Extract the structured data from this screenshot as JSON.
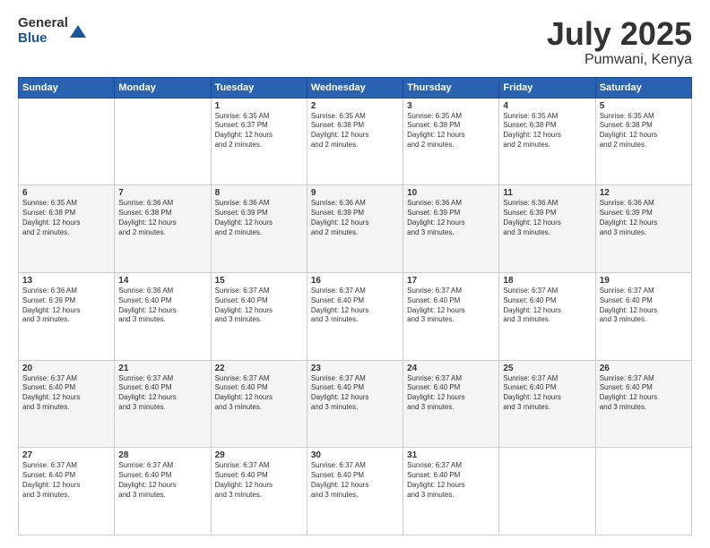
{
  "logo": {
    "general": "General",
    "blue": "Blue"
  },
  "title": {
    "month": "July 2025",
    "location": "Pumwani, Kenya"
  },
  "days_header": [
    "Sunday",
    "Monday",
    "Tuesday",
    "Wednesday",
    "Thursday",
    "Friday",
    "Saturday"
  ],
  "weeks": [
    [
      {
        "num": "",
        "info": ""
      },
      {
        "num": "",
        "info": ""
      },
      {
        "num": "1",
        "info": "Sunrise: 6:35 AM\nSunset: 6:37 PM\nDaylight: 12 hours\nand 2 minutes."
      },
      {
        "num": "2",
        "info": "Sunrise: 6:35 AM\nSunset: 6:38 PM\nDaylight: 12 hours\nand 2 minutes."
      },
      {
        "num": "3",
        "info": "Sunrise: 6:35 AM\nSunset: 6:38 PM\nDaylight: 12 hours\nand 2 minutes."
      },
      {
        "num": "4",
        "info": "Sunrise: 6:35 AM\nSunset: 6:38 PM\nDaylight: 12 hours\nand 2 minutes."
      },
      {
        "num": "5",
        "info": "Sunrise: 6:35 AM\nSunset: 6:38 PM\nDaylight: 12 hours\nand 2 minutes."
      }
    ],
    [
      {
        "num": "6",
        "info": "Sunrise: 6:35 AM\nSunset: 6:38 PM\nDaylight: 12 hours\nand 2 minutes."
      },
      {
        "num": "7",
        "info": "Sunrise: 6:36 AM\nSunset: 6:38 PM\nDaylight: 12 hours\nand 2 minutes."
      },
      {
        "num": "8",
        "info": "Sunrise: 6:36 AM\nSunset: 6:39 PM\nDaylight: 12 hours\nand 2 minutes."
      },
      {
        "num": "9",
        "info": "Sunrise: 6:36 AM\nSunset: 6:39 PM\nDaylight: 12 hours\nand 2 minutes."
      },
      {
        "num": "10",
        "info": "Sunrise: 6:36 AM\nSunset: 6:39 PM\nDaylight: 12 hours\nand 3 minutes."
      },
      {
        "num": "11",
        "info": "Sunrise: 6:36 AM\nSunset: 6:39 PM\nDaylight: 12 hours\nand 3 minutes."
      },
      {
        "num": "12",
        "info": "Sunrise: 6:36 AM\nSunset: 6:39 PM\nDaylight: 12 hours\nand 3 minutes."
      }
    ],
    [
      {
        "num": "13",
        "info": "Sunrise: 6:36 AM\nSunset: 6:39 PM\nDaylight: 12 hours\nand 3 minutes."
      },
      {
        "num": "14",
        "info": "Sunrise: 6:36 AM\nSunset: 6:40 PM\nDaylight: 12 hours\nand 3 minutes."
      },
      {
        "num": "15",
        "info": "Sunrise: 6:37 AM\nSunset: 6:40 PM\nDaylight: 12 hours\nand 3 minutes."
      },
      {
        "num": "16",
        "info": "Sunrise: 6:37 AM\nSunset: 6:40 PM\nDaylight: 12 hours\nand 3 minutes."
      },
      {
        "num": "17",
        "info": "Sunrise: 6:37 AM\nSunset: 6:40 PM\nDaylight: 12 hours\nand 3 minutes."
      },
      {
        "num": "18",
        "info": "Sunrise: 6:37 AM\nSunset: 6:40 PM\nDaylight: 12 hours\nand 3 minutes."
      },
      {
        "num": "19",
        "info": "Sunrise: 6:37 AM\nSunset: 6:40 PM\nDaylight: 12 hours\nand 3 minutes."
      }
    ],
    [
      {
        "num": "20",
        "info": "Sunrise: 6:37 AM\nSunset: 6:40 PM\nDaylight: 12 hours\nand 3 minutes."
      },
      {
        "num": "21",
        "info": "Sunrise: 6:37 AM\nSunset: 6:40 PM\nDaylight: 12 hours\nand 3 minutes."
      },
      {
        "num": "22",
        "info": "Sunrise: 6:37 AM\nSunset: 6:40 PM\nDaylight: 12 hours\nand 3 minutes."
      },
      {
        "num": "23",
        "info": "Sunrise: 6:37 AM\nSunset: 6:40 PM\nDaylight: 12 hours\nand 3 minutes."
      },
      {
        "num": "24",
        "info": "Sunrise: 6:37 AM\nSunset: 6:40 PM\nDaylight: 12 hours\nand 3 minutes."
      },
      {
        "num": "25",
        "info": "Sunrise: 6:37 AM\nSunset: 6:40 PM\nDaylight: 12 hours\nand 3 minutes."
      },
      {
        "num": "26",
        "info": "Sunrise: 6:37 AM\nSunset: 6:40 PM\nDaylight: 12 hours\nand 3 minutes."
      }
    ],
    [
      {
        "num": "27",
        "info": "Sunrise: 6:37 AM\nSunset: 6:40 PM\nDaylight: 12 hours\nand 3 minutes."
      },
      {
        "num": "28",
        "info": "Sunrise: 6:37 AM\nSunset: 6:40 PM\nDaylight: 12 hours\nand 3 minutes."
      },
      {
        "num": "29",
        "info": "Sunrise: 6:37 AM\nSunset: 6:40 PM\nDaylight: 12 hours\nand 3 minutes."
      },
      {
        "num": "30",
        "info": "Sunrise: 6:37 AM\nSunset: 6:40 PM\nDaylight: 12 hours\nand 3 minutes."
      },
      {
        "num": "31",
        "info": "Sunrise: 6:37 AM\nSunset: 6:40 PM\nDaylight: 12 hours\nand 3 minutes."
      },
      {
        "num": "",
        "info": ""
      },
      {
        "num": "",
        "info": ""
      }
    ]
  ]
}
